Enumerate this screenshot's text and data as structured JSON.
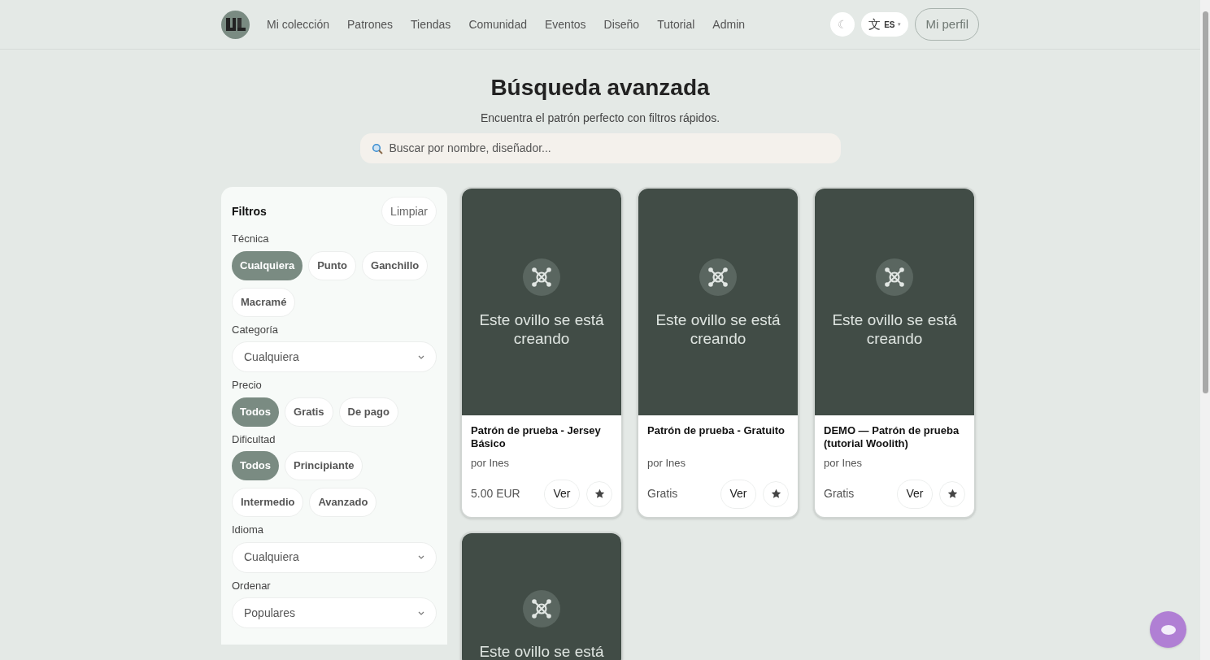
{
  "nav": {
    "items": [
      {
        "label": "Mi colección"
      },
      {
        "label": "Patrones"
      },
      {
        "label": "Tiendas"
      },
      {
        "label": "Comunidad"
      },
      {
        "label": "Eventos"
      },
      {
        "label": "Diseño"
      },
      {
        "label": "Tutorial"
      },
      {
        "label": "Admin"
      }
    ],
    "theme_toggle": "☾",
    "language": {
      "icon": "文",
      "code": "ES",
      "caret": "▾"
    },
    "profile": "Mi perfil"
  },
  "header": {
    "title": "Búsqueda avanzada",
    "subtitle": "Encuentra el patrón perfecto con filtros rápidos.",
    "search": {
      "placeholder": "Buscar por nombre, diseñador..."
    }
  },
  "filters": {
    "title": "Filtros",
    "clear": "Limpiar",
    "groups": [
      {
        "kind": "chips",
        "label": "Técnica",
        "options": [
          {
            "label": "Cualquiera",
            "selected": true
          },
          {
            "label": "Punto",
            "selected": false
          },
          {
            "label": "Ganchillo",
            "selected": false
          },
          {
            "label": "Macramé",
            "selected": false
          }
        ]
      },
      {
        "kind": "select",
        "label": "Categoría",
        "value": "Cualquiera"
      },
      {
        "kind": "chips",
        "label": "Precio",
        "options": [
          {
            "label": "Todos",
            "selected": true
          },
          {
            "label": "Gratis",
            "selected": false
          },
          {
            "label": "De pago",
            "selected": false
          }
        ]
      },
      {
        "kind": "chips",
        "label": "Dificultad",
        "options": [
          {
            "label": "Todos",
            "selected": true
          },
          {
            "label": "Principiante",
            "selected": false
          },
          {
            "label": "Intermedio",
            "selected": false
          },
          {
            "label": "Avanzado",
            "selected": false
          }
        ]
      },
      {
        "kind": "select",
        "label": "Idioma",
        "value": "Cualquiera"
      },
      {
        "kind": "select",
        "label": "Ordenar",
        "value": "Populares"
      }
    ]
  },
  "results": [
    {
      "placeholder": "Este ovillo se está creando",
      "title": "Patrón de prueba - Jersey Básico",
      "author": "por Ines",
      "price": "5.00 EUR",
      "view": "Ver"
    },
    {
      "placeholder": "Este ovillo se está creando",
      "title": "Patrón de prueba - Gratuito",
      "author": "por Ines",
      "price": "Gratis",
      "view": "Ver"
    },
    {
      "placeholder": "Este ovillo se está creando",
      "title": "DEMO — Patrón de prueba (tutorial Woolith)",
      "author": "por Ines",
      "price": "Gratis",
      "view": "Ver"
    },
    {
      "placeholder": "Este ovillo se está"
    }
  ]
}
